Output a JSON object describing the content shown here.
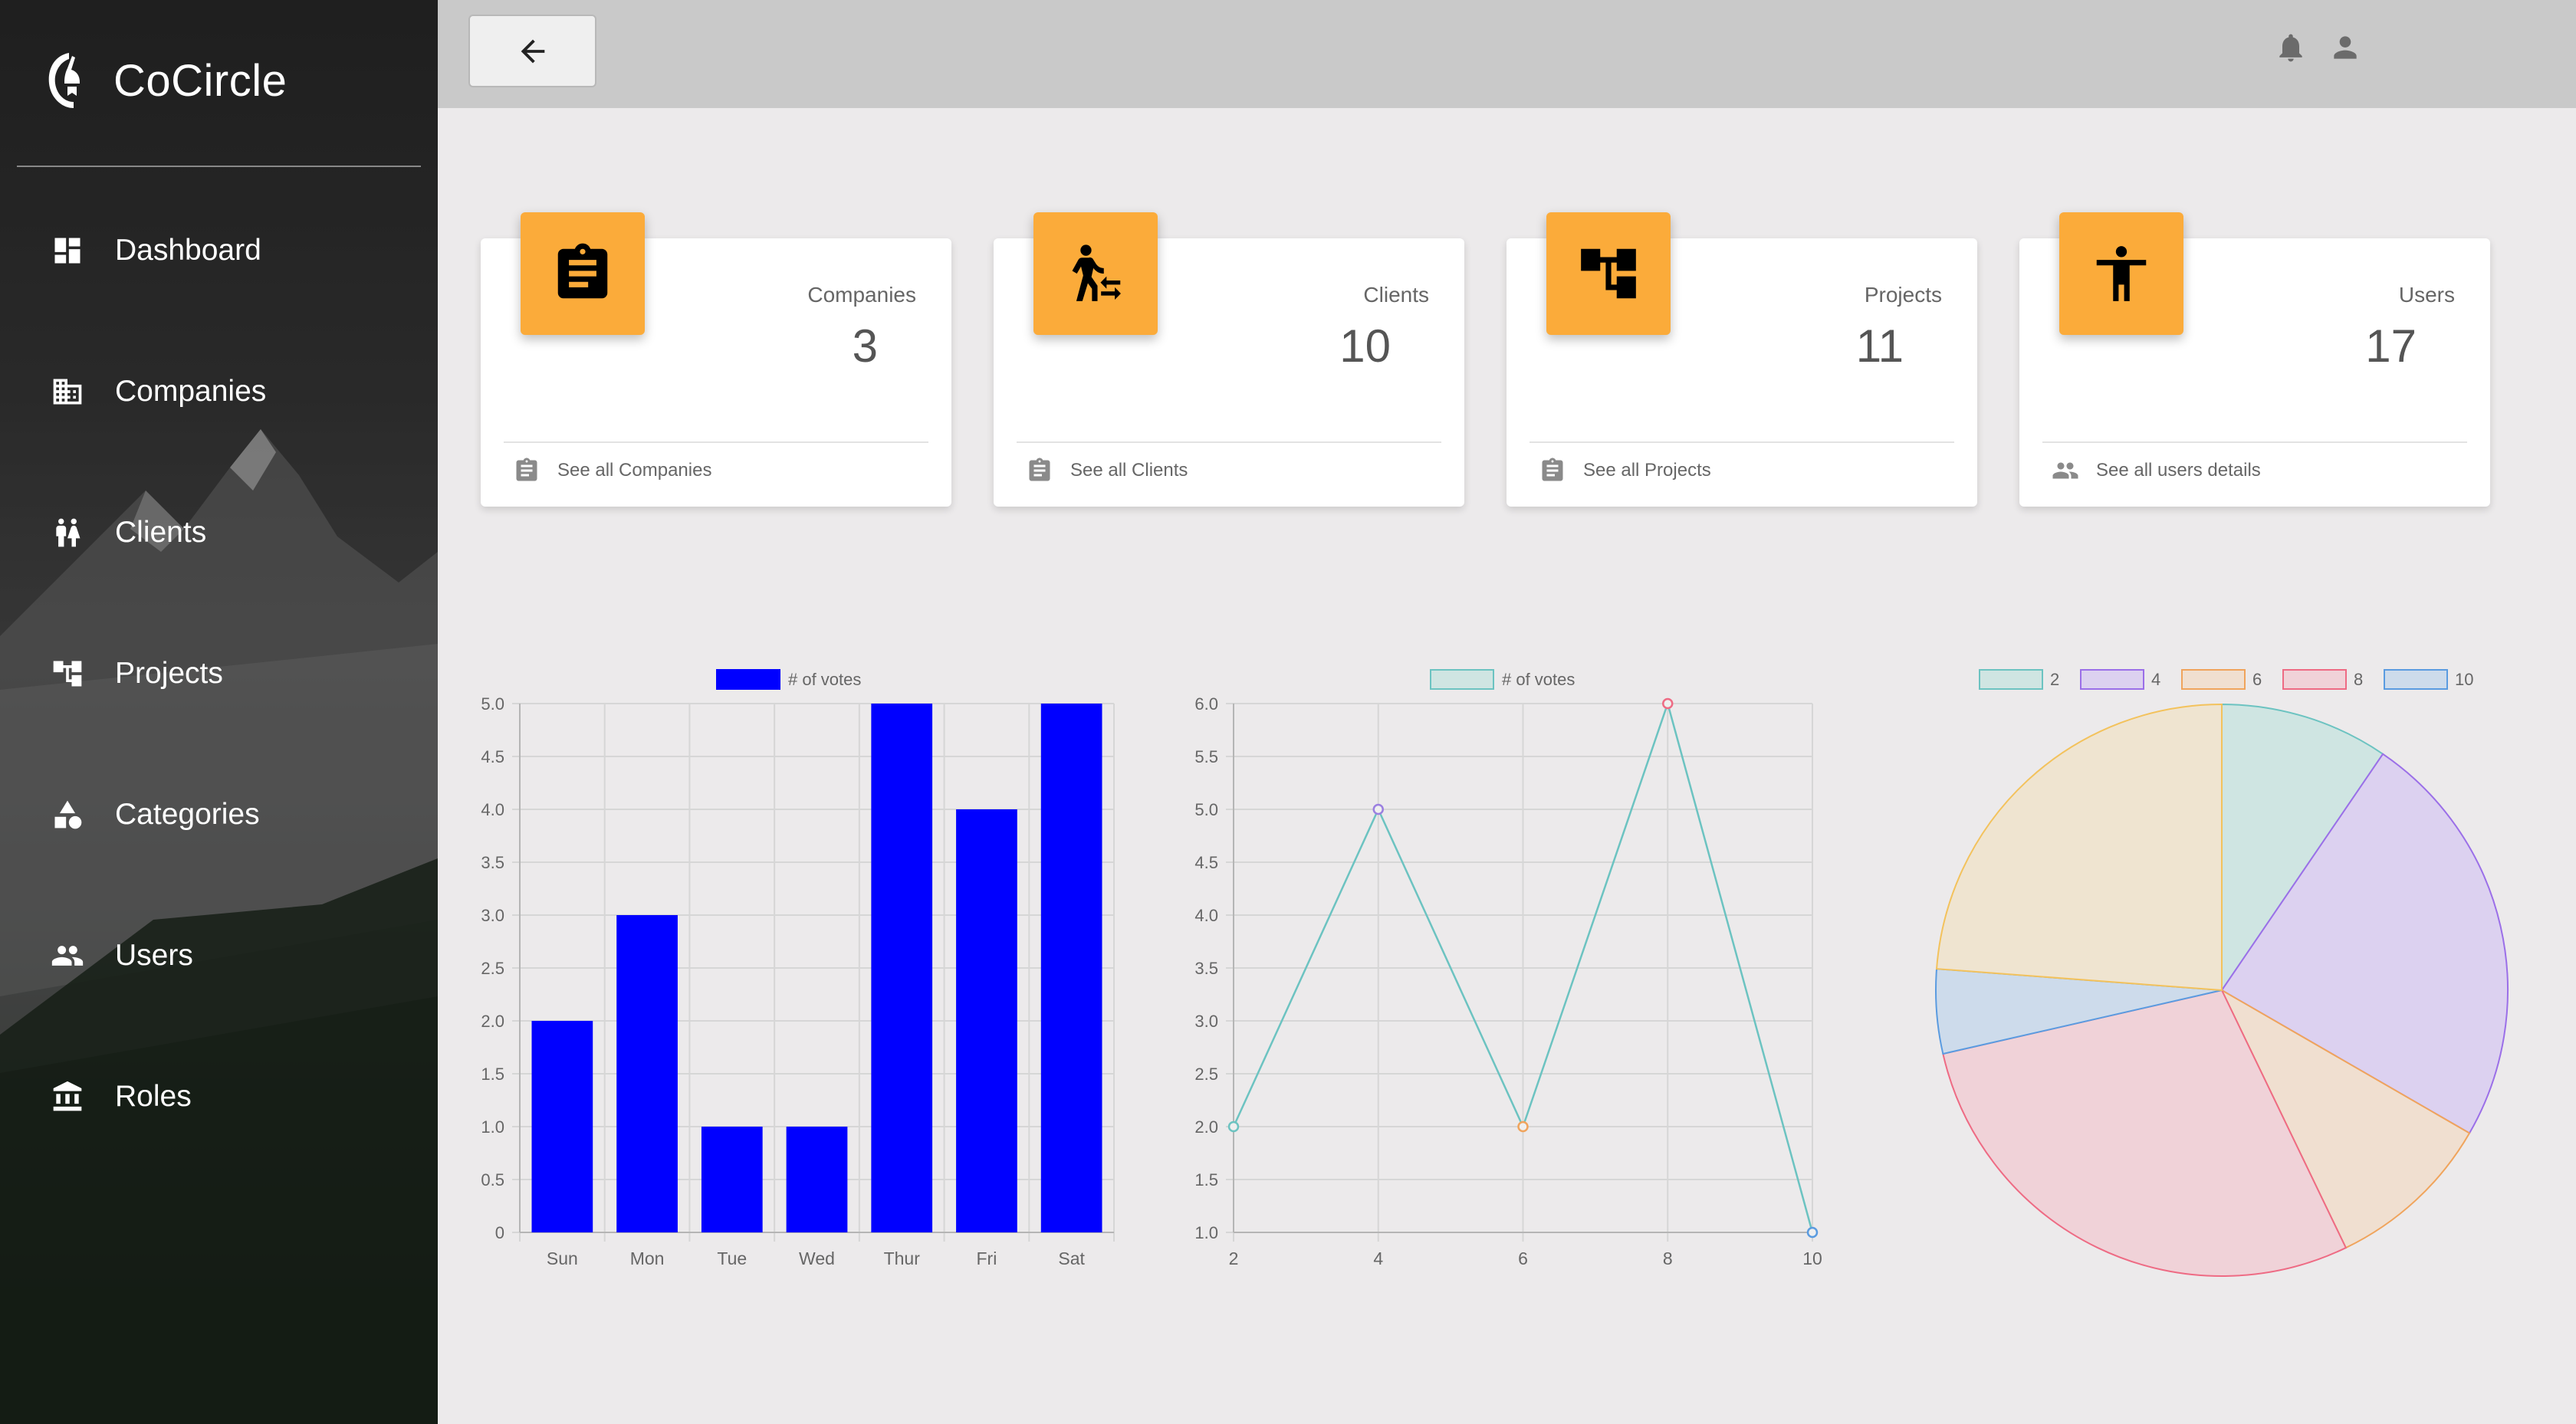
{
  "app": {
    "name": "CoCircle"
  },
  "sidebar": {
    "items": [
      {
        "label": "Dashboard",
        "icon": "dashboard-icon"
      },
      {
        "label": "Companies",
        "icon": "building-icon"
      },
      {
        "label": "Clients",
        "icon": "people-icon"
      },
      {
        "label": "Projects",
        "icon": "project-tree-icon"
      },
      {
        "label": "Categories",
        "icon": "category-shapes-icon"
      },
      {
        "label": "Users",
        "icon": "group-icon"
      },
      {
        "label": "Roles",
        "icon": "roles-icon"
      }
    ]
  },
  "topbar": {
    "back_icon": "arrow-left-icon",
    "notification_icon": "bell-icon",
    "user_icon": "person-icon"
  },
  "cards": [
    {
      "title": "Companies",
      "value": "3",
      "link": "See all Companies",
      "badge_icon": "clipboard-icon",
      "footer_icon": "clipboard-icon"
    },
    {
      "title": "Clients",
      "value": "10",
      "link": "See all Clients",
      "badge_icon": "person-transfer-icon",
      "footer_icon": "clipboard-icon"
    },
    {
      "title": "Projects",
      "value": "11",
      "link": "See all Projects",
      "badge_icon": "project-tree-icon",
      "footer_icon": "clipboard-icon"
    },
    {
      "title": "Users",
      "value": "17",
      "link": "See all users details",
      "badge_icon": "accessibility-icon",
      "footer_icon": "group-icon"
    }
  ],
  "colors": {
    "accent": "#fbab3a",
    "sidebar_text": "#ffffff",
    "topbar": "#c9c9c9",
    "background": "#eceaeb"
  },
  "chart_data": [
    {
      "type": "bar",
      "categories": [
        "Sun",
        "Mon",
        "Tue",
        "Wed",
        "Thur",
        "Fri",
        "Sat"
      ],
      "series": [
        {
          "name": "# of votes",
          "values": [
            2,
            3,
            1,
            1,
            5,
            4,
            5
          ],
          "color": "#0000ff"
        }
      ],
      "ylim": [
        0,
        5
      ],
      "yticks": [
        "0",
        "0.5",
        "1.0",
        "1.5",
        "2.0",
        "2.5",
        "3.0",
        "3.5",
        "4.0",
        "4.5",
        "5.0"
      ],
      "legend": "top-center",
      "grid": true
    },
    {
      "type": "line",
      "x": [
        2,
        4,
        6,
        8,
        10
      ],
      "xticks": [
        "2",
        "4",
        "6",
        "8",
        "10"
      ],
      "series": [
        {
          "name": "# of votes",
          "values": [
            2,
            5,
            2,
            6,
            1
          ],
          "color": "#6cc3c1"
        }
      ],
      "point_colors": [
        "#6cc3c1",
        "#9b7fe0",
        "#f0a45c",
        "#ee6b84",
        "#5a9be0"
      ],
      "ylim": [
        1,
        6
      ],
      "yticks": [
        "1.0",
        "1.5",
        "2.0",
        "2.5",
        "3.0",
        "3.5",
        "4.0",
        "4.5",
        "5.0",
        "5.5",
        "6.0"
      ],
      "legend": "top-center",
      "grid": true
    },
    {
      "type": "pie",
      "categories": [
        "2",
        "4",
        "6",
        "8",
        "10"
      ],
      "values": [
        2,
        5,
        2,
        6,
        1
      ],
      "fills": [
        "#cfe5e2",
        "#dcd1f0",
        "#f0dfd0",
        "#f0d2d8",
        "#cddbeb"
      ],
      "strokes": [
        "#6cc3c1",
        "#9b6fe8",
        "#f0a45c",
        "#ee6b84",
        "#5a9be0"
      ],
      "extra_slice": {
        "value": 5,
        "fill": "#efe4d0",
        "stroke": "#f3c25c"
      },
      "legend": "top-center"
    }
  ]
}
